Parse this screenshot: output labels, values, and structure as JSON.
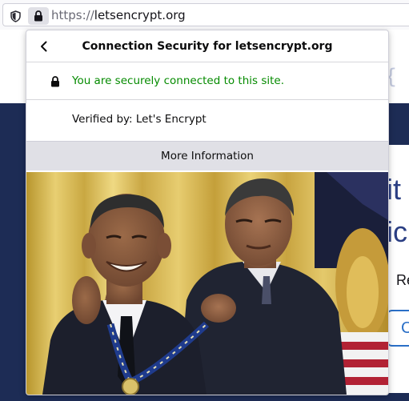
{
  "urlbar": {
    "url_scheme": "https://",
    "url_host": "letsencrypt.org",
    "shield_icon": "tracking-protection-shield-icon",
    "lock_icon": "padlock-icon"
  },
  "page": {
    "bracket_glyph": "{",
    "heading_line1": "it C",
    "heading_line2": "ic",
    "text_fragment": "Re",
    "pill_fragment": "C"
  },
  "panel": {
    "back_icon": "chevron-left-icon",
    "title": "Connection Security for letsencrypt.org",
    "secure_text": "You are securely connected to this site.",
    "verified_text": "Verified by: Let's Encrypt",
    "more_info_label": "More Information"
  },
  "colors": {
    "secure_green": "#058b00",
    "page_navy": "#1d2c55",
    "heading_blue": "#2a3e83",
    "panel_footer_gray": "#e0e0e6"
  },
  "photo": {
    "subject": "meme-photo-self-medal-ceremony"
  }
}
